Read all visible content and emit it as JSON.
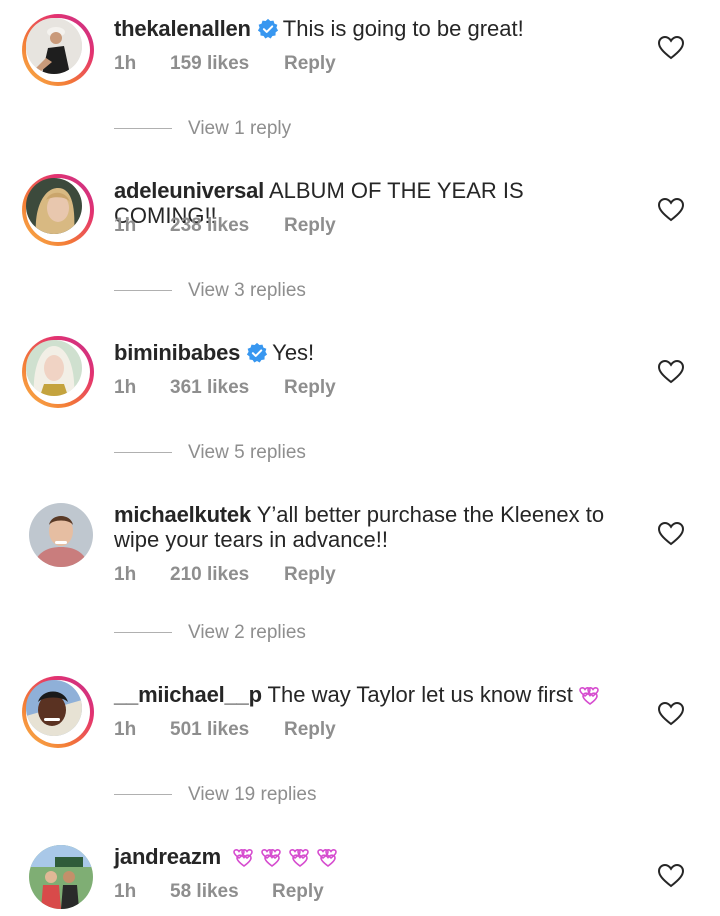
{
  "comments": [
    {
      "username": "thekalenallen",
      "verified": true,
      "text": "This is going to be great!",
      "time": "1h",
      "likes": "159 likes",
      "reply": "Reply",
      "view_replies": "View 1 reply"
    },
    {
      "username": "adeleuniversal",
      "verified": false,
      "text": "ALBUM OF THE YEAR IS COMING!!",
      "time": "1h",
      "likes": "238 likes",
      "reply": "Reply",
      "view_replies": "View 3 replies"
    },
    {
      "username": "biminibabes",
      "verified": true,
      "text": "Yes!",
      "time": "1h",
      "likes": "361 likes",
      "reply": "Reply",
      "view_replies": "View 5 replies"
    },
    {
      "username": "michaelkutek",
      "verified": false,
      "text": "Y’all better purchase the Kleenex to",
      "text_line2": "wipe your tears in advance!!",
      "time": "1h",
      "likes": "210 likes",
      "reply": "Reply",
      "view_replies": "View 2 replies"
    },
    {
      "username": "__miichael__p",
      "verified": false,
      "text": "The way Taylor let us know first",
      "time": "1h",
      "likes": "501 likes",
      "reply": "Reply",
      "view_replies": "View 19 replies"
    },
    {
      "username": "jandreazm",
      "verified": false,
      "text": "",
      "time": "1h",
      "likes": "58 likes",
      "reply": "Reply"
    }
  ],
  "icons": {
    "like": "heart-outline-icon",
    "verified": "verified-badge-icon",
    "emoji": "two-hearts-emoji"
  },
  "colors": {
    "muted": "#8e8e8e",
    "verified": "#3897f0",
    "emoji": "#d64ccf"
  }
}
